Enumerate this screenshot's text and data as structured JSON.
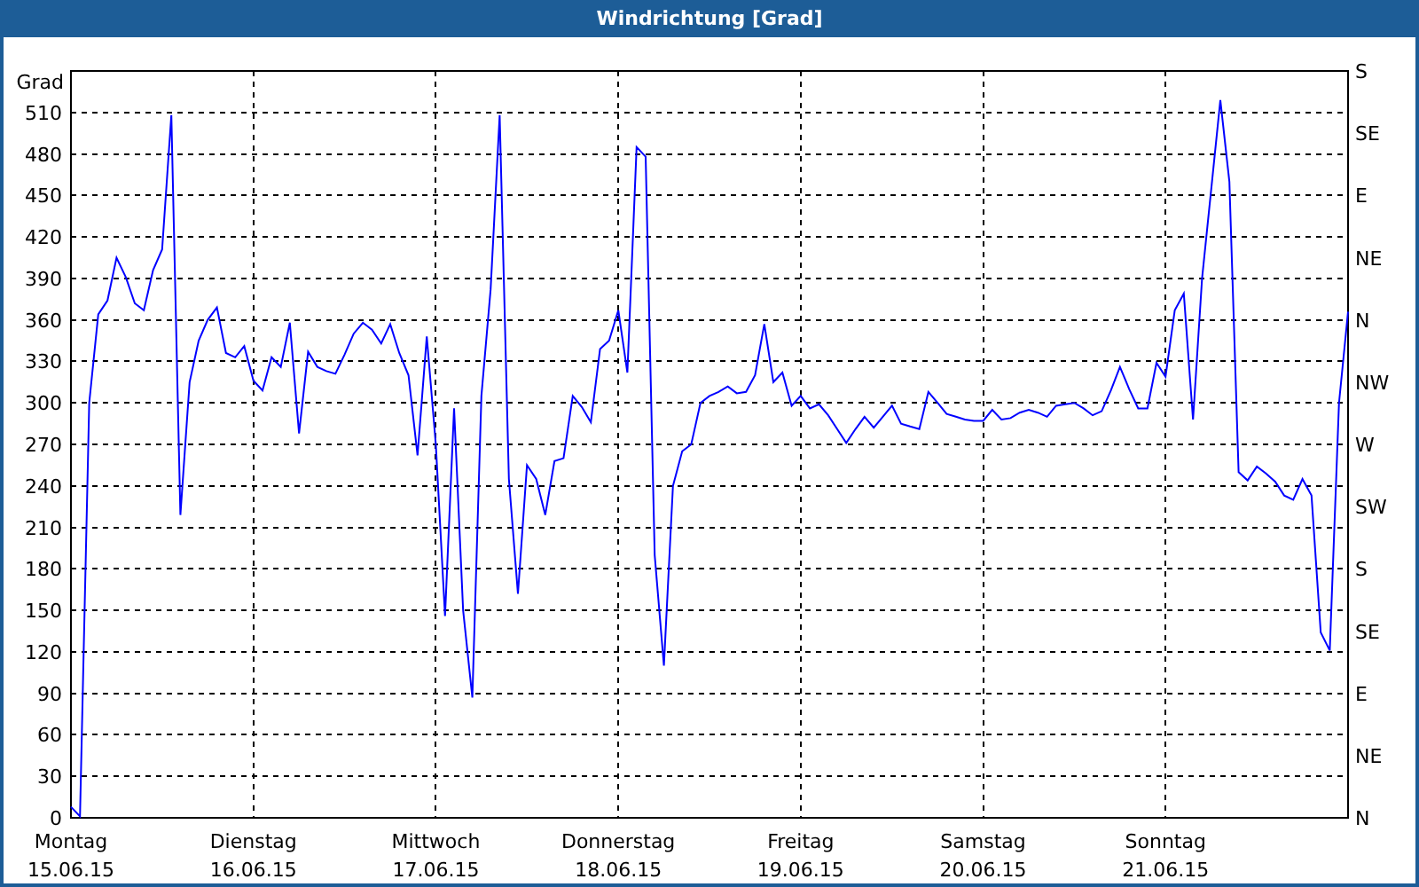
{
  "window": {
    "title": "Windrichtung [Grad]"
  },
  "chart": {
    "chart_data": {
      "type": "line",
      "grid": true,
      "ylabel": "Grad",
      "ylim": [
        0,
        540
      ],
      "yticks": [
        0,
        30,
        60,
        90,
        120,
        150,
        180,
        210,
        240,
        270,
        300,
        330,
        360,
        390,
        420,
        450,
        480,
        510
      ],
      "categories": [
        "Montag",
        null,
        null,
        null,
        null,
        null,
        null,
        null,
        null,
        null,
        null,
        null,
        null,
        null,
        null,
        null,
        null,
        null,
        null,
        null,
        "Dienstag",
        null,
        null,
        null,
        null,
        null,
        null,
        null,
        null,
        null,
        null,
        null,
        null,
        null,
        null,
        null,
        null,
        null,
        null,
        null,
        "Mittwoch",
        null,
        null,
        null,
        null,
        null,
        null,
        null,
        null,
        null,
        null,
        null,
        null,
        null,
        null,
        null,
        null,
        null,
        null,
        null,
        "Donnerstag",
        null,
        null,
        null,
        null,
        null,
        null,
        null,
        null,
        null,
        null,
        null,
        null,
        null,
        null,
        null,
        null,
        null,
        null,
        null,
        "Freitag",
        null,
        null,
        null,
        null,
        null,
        null,
        null,
        null,
        null,
        null,
        null,
        null,
        null,
        null,
        null,
        null,
        null,
        null,
        null,
        "Samstag",
        null,
        null,
        null,
        null,
        null,
        null,
        null,
        null,
        null,
        null,
        null,
        null,
        null,
        null,
        null,
        null,
        null,
        null,
        null,
        "Sonntag",
        null,
        null,
        null,
        null,
        null,
        null,
        null,
        null,
        null,
        null,
        null,
        null,
        null,
        null,
        null,
        null,
        null,
        null,
        null,
        null
      ],
      "series": [
        {
          "color": "#0000ff",
          "values": [
            8,
            1,
            300,
            364,
            374,
            405,
            391,
            372,
            367,
            396,
            411,
            508,
            219,
            315,
            345,
            360,
            369,
            336,
            333,
            341,
            316,
            309,
            333,
            326,
            358,
            278,
            337,
            326,
            323,
            321,
            335,
            350,
            358,
            353,
            343,
            357,
            336,
            320,
            262,
            348,
            270,
            146,
            296,
            150,
            87,
            305,
            382,
            508,
            245,
            162,
            255,
            245,
            219,
            258,
            260,
            305,
            297,
            286,
            339,
            345,
            367,
            322,
            485,
            478,
            190,
            110,
            240,
            265,
            270,
            300,
            305,
            308,
            312,
            307,
            308,
            320,
            357,
            315,
            322,
            298,
            305,
            296,
            299,
            291,
            281,
            271,
            281,
            290,
            282,
            290,
            298,
            285,
            283,
            281,
            308,
            300,
            292,
            290,
            288,
            287,
            287,
            295,
            288,
            289,
            293,
            295,
            293,
            290,
            298,
            299,
            300,
            296,
            291,
            294,
            309,
            326,
            310,
            296,
            296,
            329,
            319,
            367,
            379,
            288,
            390,
            455,
            519,
            460,
            250,
            244,
            254,
            249,
            243,
            233,
            230,
            245,
            233,
            134,
            121,
            300,
            366
          ]
        }
      ]
    }
  },
  "x_dates": [
    "15.06.15",
    "16.06.15",
    "17.06.15",
    "18.06.15",
    "19.06.15",
    "20.06.15",
    "21.06.15"
  ],
  "compass_labels": [
    "S",
    "SE",
    "E",
    "NE",
    "N",
    "NW",
    "W",
    "SW",
    "S",
    "SE",
    "E",
    "NE",
    "N"
  ]
}
